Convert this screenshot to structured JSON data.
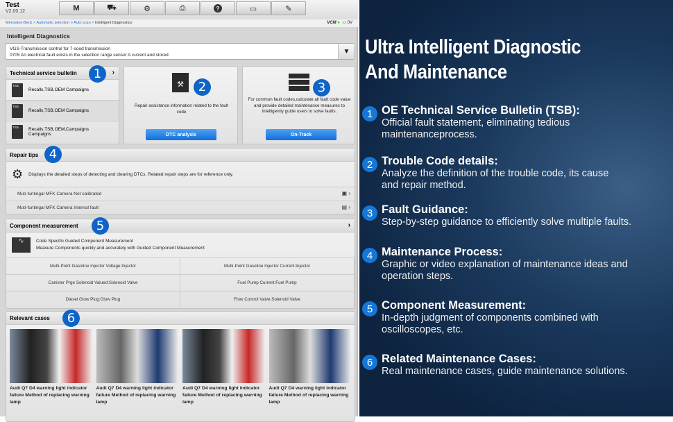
{
  "app": {
    "title": "Test",
    "version": "V2.00.12"
  },
  "toolbar": [
    {
      "icon": "home-icon",
      "glyph": "M"
    },
    {
      "icon": "vehicle-lift-icon",
      "glyph": "⛟"
    },
    {
      "icon": "gear-icon",
      "glyph": "⚙"
    },
    {
      "icon": "printer-icon",
      "glyph": "⎙"
    },
    {
      "icon": "help-icon",
      "glyph": "?"
    },
    {
      "icon": "save-icon",
      "glyph": "▭"
    },
    {
      "icon": "pencil-icon",
      "glyph": "✎"
    }
  ],
  "breadcrumb": {
    "items": [
      "Mercedes-Benz",
      "Automatic selection",
      "Auto scan"
    ],
    "sep": " > ",
    "current": "Intelligent Diagnostics"
  },
  "status": {
    "vcm": "VCM",
    "voltage": "0V"
  },
  "section_title": "Intelligent Diagnostics",
  "fault_select": {
    "line1": "VGS-Transmission control for 7-sood transmission",
    "line2": "0705 An electrical fault exists in the selection range sensor A current and stored"
  },
  "tsb": {
    "title": "Technical service bulletin",
    "badge": "1",
    "items": [
      "Recalls,TSB,OEM Campaigns",
      "Recalls,TSB,OEM Campaigns",
      "Recalls,TSB,OEM,Campaigns Campaigns"
    ],
    "icon_label": "TSB"
  },
  "dtc": {
    "badge": "2",
    "text": "Repair assistance information related to the fault code",
    "button": "DTC analysis"
  },
  "ontrack": {
    "badge": "3",
    "text": "For common fault codes,calculate all fault code value and provide detailed maintenance measures to intelligently guide users to solve faults.",
    "button": "On-Track"
  },
  "repair_tips": {
    "title": "Repair tips",
    "badge": "4",
    "desc": "Displays the detailed steps of detecting and clearing DTCs. Related repair steps are for reference only.",
    "rows": [
      "Muti-funtingal MFK Camera Not calibrated",
      "Muti-funtingal MFK Camera Internal fault"
    ]
  },
  "component": {
    "title": "Component measurement",
    "badge": "5",
    "desc1": "Code Specific Guided Component Measurement",
    "desc2": "Measure Components quickly and accurately with Guided Component Measurement",
    "cells": [
      "Multi-Point Gasoline Injector Voltage:Injector",
      "Multi-Point Gasoline Injector Current:Injector",
      "Canister Prge Solenoid Valued:Solenoid Valve",
      "Fuel Pump Current:Fuel Pump",
      "Diesel Glow Plug:Glow Plug",
      "Flow Control Valve:Solenoid Valve"
    ]
  },
  "cases": {
    "title": "Relevant cases",
    "badge": "6",
    "items": [
      "Audi Q7 D4 warning light indicator failure Method of replacing warning lamp",
      "Audi Q7 D4 warning light indicator failure Method of replacing warning lamp",
      "Audi Q7 D4 warning light indicator failure Method of replacing warning lamp",
      "Audi Q7 D4 warning light indicator failure Method of replacing warning lamp"
    ]
  },
  "promo": {
    "title_line1": "Ultra Intelligent Diagnostic",
    "title_line2": "And Maintenance",
    "items": [
      {
        "num": "1",
        "heading": "OE Technical Service Bulletin (TSB)",
        "desc": "Official fault  statement, eliminating tedious maintenanceprocess."
      },
      {
        "num": "2",
        "heading": "Trouble Code details",
        "desc": "Analyze the definition of the trouble code, its cause and repair method."
      },
      {
        "num": "3",
        "heading": "Fault Guidance",
        "desc": "Step-by-step guidance to efficiently solve multiple faults."
      },
      {
        "num": "4",
        "heading": "Maintenance Process",
        "desc": "Graphic or video explanation of maintenance ideas and operation steps."
      },
      {
        "num": "5",
        "heading": "Component Measurement",
        "desc": "In-depth judgment of components combined with oscilloscopes, etc."
      },
      {
        "num": "6",
        "heading": "Related Maintenance Cases",
        "desc": "Real maintenance cases, guide maintenance solutions."
      }
    ]
  }
}
